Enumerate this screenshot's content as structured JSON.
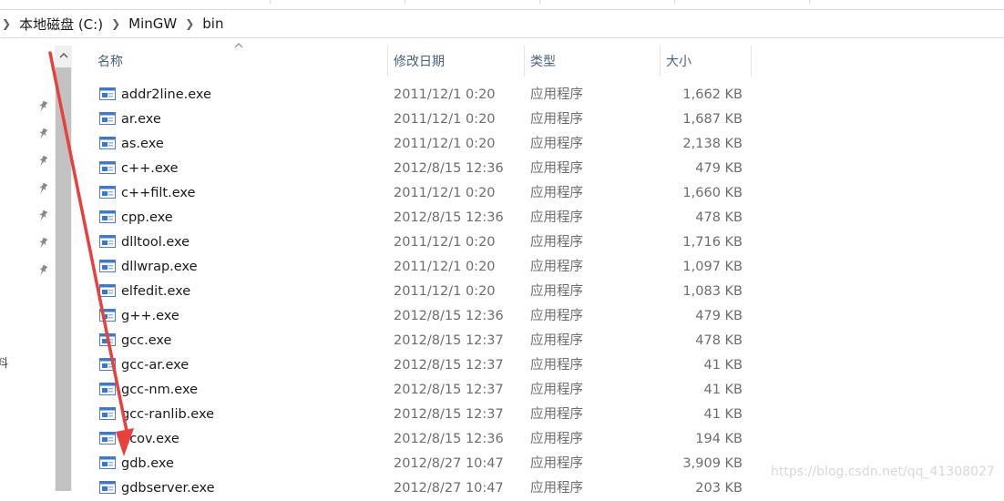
{
  "breadcrumb": {
    "items": [
      "本地磁盘 (C:)",
      "MinGW",
      "bin"
    ]
  },
  "nav": {
    "partial_label": "料"
  },
  "columns": {
    "name": "名称",
    "date": "修改日期",
    "type": "类型",
    "size": "大小"
  },
  "files": [
    {
      "name": "addr2line.exe",
      "date": "2011/12/1 0:20",
      "type": "应用程序",
      "size": "1,662 KB"
    },
    {
      "name": "ar.exe",
      "date": "2011/12/1 0:20",
      "type": "应用程序",
      "size": "1,687 KB"
    },
    {
      "name": "as.exe",
      "date": "2011/12/1 0:20",
      "type": "应用程序",
      "size": "2,138 KB"
    },
    {
      "name": "c++.exe",
      "date": "2012/8/15 12:36",
      "type": "应用程序",
      "size": "479 KB"
    },
    {
      "name": "c++filt.exe",
      "date": "2011/12/1 0:20",
      "type": "应用程序",
      "size": "1,660 KB"
    },
    {
      "name": "cpp.exe",
      "date": "2012/8/15 12:36",
      "type": "应用程序",
      "size": "478 KB"
    },
    {
      "name": "dlltool.exe",
      "date": "2011/12/1 0:20",
      "type": "应用程序",
      "size": "1,716 KB"
    },
    {
      "name": "dllwrap.exe",
      "date": "2011/12/1 0:20",
      "type": "应用程序",
      "size": "1,097 KB"
    },
    {
      "name": "elfedit.exe",
      "date": "2011/12/1 0:20",
      "type": "应用程序",
      "size": "1,083 KB"
    },
    {
      "name": "g++.exe",
      "date": "2012/8/15 12:36",
      "type": "应用程序",
      "size": "479 KB"
    },
    {
      "name": "gcc.exe",
      "date": "2012/8/15 12:37",
      "type": "应用程序",
      "size": "478 KB"
    },
    {
      "name": "gcc-ar.exe",
      "date": "2012/8/15 12:37",
      "type": "应用程序",
      "size": "41 KB"
    },
    {
      "name": "gcc-nm.exe",
      "date": "2012/8/15 12:37",
      "type": "应用程序",
      "size": "41 KB"
    },
    {
      "name": "gcc-ranlib.exe",
      "date": "2012/8/15 12:37",
      "type": "应用程序",
      "size": "41 KB"
    },
    {
      "name": "gcov.exe",
      "date": "2012/8/15 12:36",
      "type": "应用程序",
      "size": "194 KB"
    },
    {
      "name": "gdb.exe",
      "date": "2012/8/27 10:47",
      "type": "应用程序",
      "size": "3,909 KB"
    },
    {
      "name": "gdbserver.exe",
      "date": "2012/8/27 10:47",
      "type": "应用程序",
      "size": "203 KB"
    }
  ],
  "watermark": "https://blog.csdn.net/qq_41308027",
  "colors": {
    "annotation_arrow": "#e8403f",
    "header_text": "#4c607a",
    "scroll_thumb": "#c2c2c2"
  }
}
